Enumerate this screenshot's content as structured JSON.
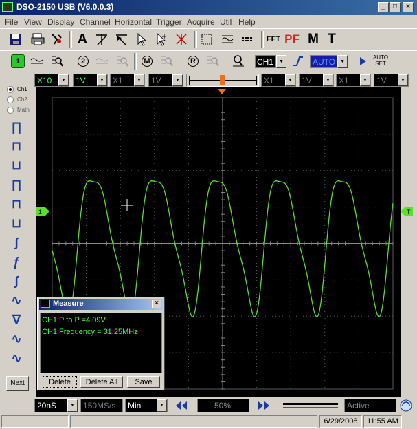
{
  "window": {
    "title": "DSO-2150 USB (V6.0.0.3)",
    "minimize": "_",
    "maximize": "□",
    "close": "×"
  },
  "menu": [
    "File",
    "View",
    "Display",
    "Channel",
    "Horizontal",
    "Trigger",
    "Acquire",
    "Util",
    "Help"
  ],
  "toolbar1": {
    "buttons": [
      "save-icon",
      "print-icon",
      "settings-icon",
      "text-icon",
      "cursor-cross-icon",
      "cursor-diag-icon",
      "pointer-icon",
      "pointer-plus-icon",
      "cursor-x-icon",
      "rect-icon",
      "wave-lines-icon",
      "lines-icon",
      "fft-icon",
      "pass-fail-icon",
      "math-icon",
      "trigger-t-icon"
    ],
    "text_labels": {
      "a": "A",
      "fft": "FFT",
      "pf": "PF",
      "m": "M",
      "t": "T"
    }
  },
  "toolbar2": {
    "ch1_num": "1",
    "ch2_num": "2",
    "math_label": "M",
    "ref_label": "R",
    "channel_combo": "CH1",
    "trigger_mode": "AUTO",
    "auto_set": "AUTO SET"
  },
  "channel_bar": {
    "probe": "X10",
    "ch1_volts": "1V",
    "ch2_probe": "X1",
    "ch2_volts": "1V",
    "math_probe": "X1",
    "math_volts": "1V",
    "ref_probe": "X1",
    "ref_volts": "1V"
  },
  "left_panel": {
    "sources": [
      "Ch1",
      "Ch2",
      "Math"
    ],
    "selected": "Ch1",
    "next_button": "Next"
  },
  "screen": {
    "background": "#000000",
    "trace_color": "#5adf2b",
    "grid_color": "#5a5a5a",
    "trigger_marker_color": "#e87020",
    "level_marker_color": "#5adf2b"
  },
  "measure": {
    "title": "Measure",
    "lines": [
      "CH1:P to P =4.09V",
      "CH1:Frequency = 31.25MHz"
    ],
    "buttons": [
      "Delete",
      "Delete All",
      "Save"
    ]
  },
  "bottom_bar": {
    "timebase": "20nS",
    "sample_rate": "150MS/s",
    "mode": "Min",
    "position": "50%",
    "state": "Active"
  },
  "status": {
    "date": "6/29/2008",
    "time": "11:55 AM"
  }
}
